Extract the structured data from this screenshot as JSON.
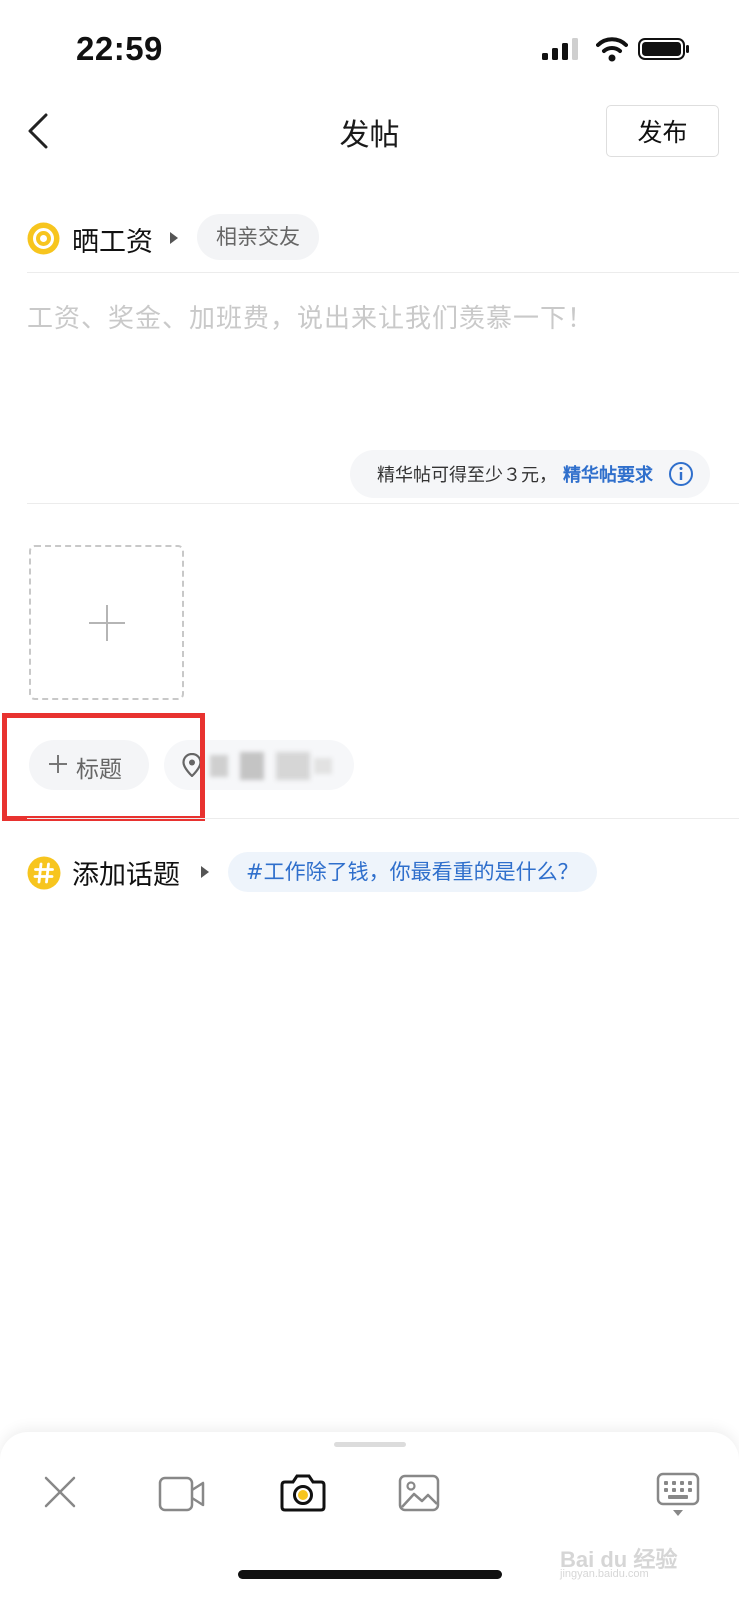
{
  "status_bar": {
    "time": "22:59"
  },
  "header": {
    "title": "发帖",
    "publish_label": "发布"
  },
  "category": {
    "label": "晒工资",
    "tag": "相亲交友"
  },
  "post_body": {
    "placeholder": "工资、奖金、加班费，说出来让我们羡慕一下！"
  },
  "essence_tip": {
    "text": "精华帖可得至少３元，",
    "link": "精华帖要求"
  },
  "title_chip": {
    "label": "标题"
  },
  "topic": {
    "label": "添加话题",
    "suggestion": "#工作除了钱，你最看重的是什么？"
  },
  "toolbar": {
    "icons": [
      "close-icon",
      "video-icon",
      "camera-icon",
      "image-icon",
      "keyboard-icon"
    ]
  },
  "watermark": {
    "text": "Bai du 经验",
    "sub": "jingyan.baidu.com"
  },
  "colors": {
    "accent_yellow": "#f7c51e",
    "link_blue": "#2f6fcc",
    "highlight_red": "#e8322f"
  }
}
